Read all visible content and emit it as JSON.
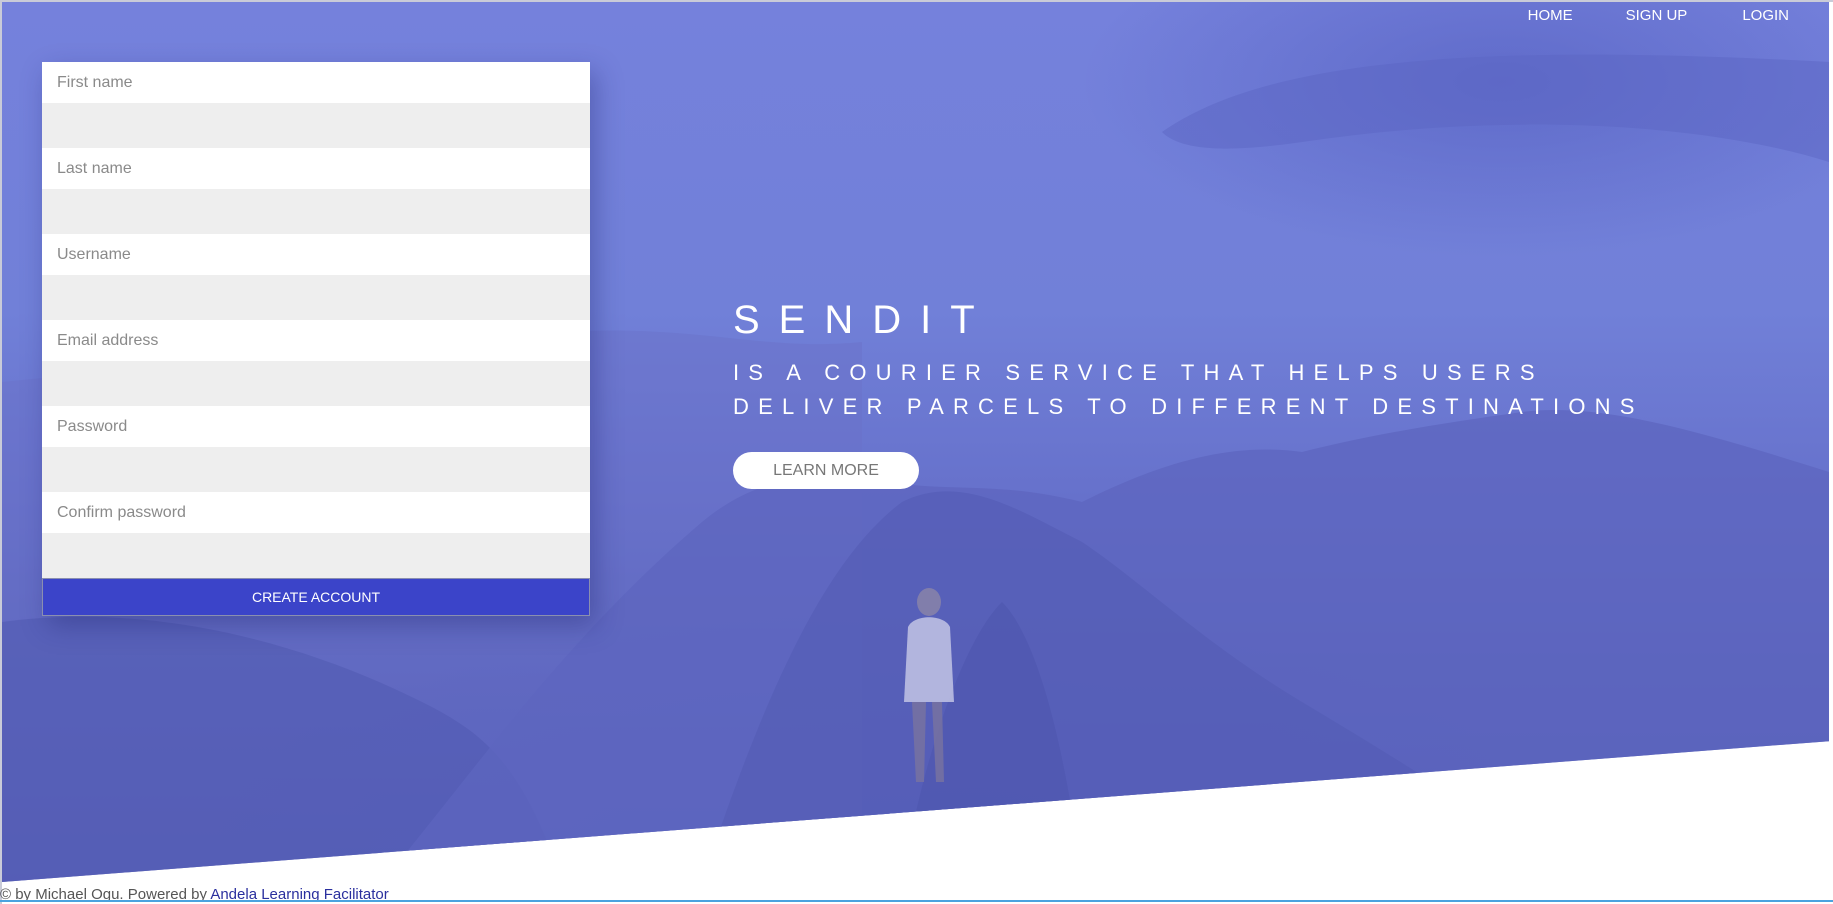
{
  "nav": {
    "home": "HOME",
    "signup": "SIGN UP",
    "login": "LOGIN"
  },
  "form": {
    "first_name_placeholder": "First name",
    "last_name_placeholder": "Last name",
    "username_placeholder": "Username",
    "email_placeholder": "Email address",
    "password_placeholder": "Password",
    "confirm_password_placeholder": "Confirm password",
    "submit_label": "CREATE ACCOUNT"
  },
  "hero": {
    "brand": "SENDIT",
    "tagline_line1": "IS A COURIER SERVICE THAT HELPS USERS",
    "tagline_line2": "DELIVER PARCELS TO DIFFERENT DESTINATIONS",
    "cta_label": "LEARN MORE"
  },
  "footer": {
    "prefix": "© by Michael Ogu. Powered by ",
    "link_text": "Andela Learning Facilitator"
  },
  "colors": {
    "hero_overlay": "#7180d8",
    "button_primary": "#3b44c9",
    "field_gap": "#eeeeee"
  }
}
